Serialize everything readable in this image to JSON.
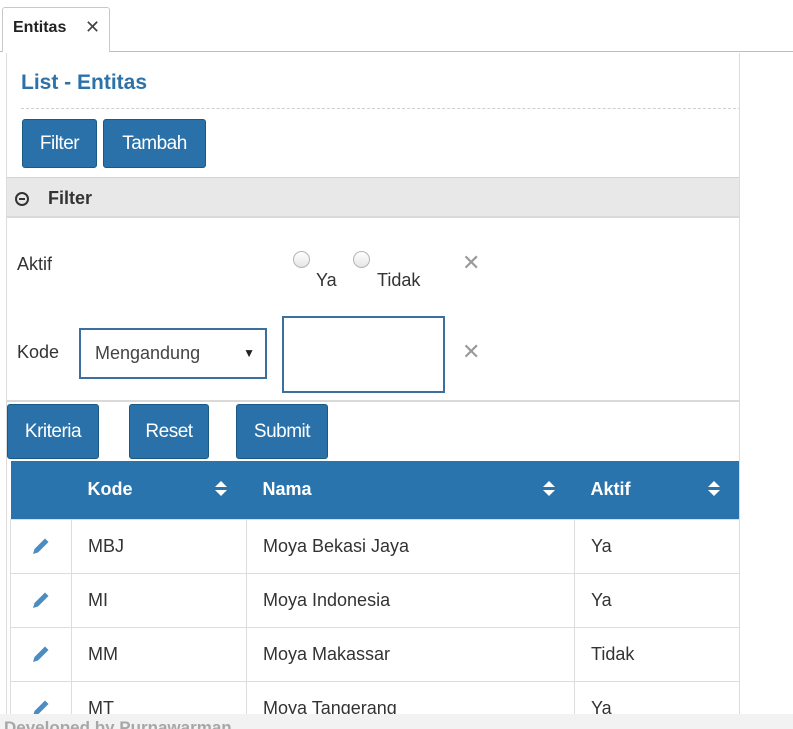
{
  "tab": {
    "label": "Entitas",
    "close": "✕"
  },
  "page": {
    "title": "List - Entitas"
  },
  "toolbar": {
    "filter_label": "Filter",
    "add_label": "Tambah"
  },
  "filter": {
    "title": "Filter",
    "aktif": {
      "label": "Aktif",
      "option_yes": "Ya",
      "option_no": "Tidak"
    },
    "kode": {
      "label": "Kode",
      "operator": "Mengandung",
      "value": ""
    },
    "clear": "✕"
  },
  "actions": {
    "criteria_label": "Kriteria",
    "reset_label": "Reset",
    "submit_label": "Submit"
  },
  "table": {
    "columns": [
      "Kode",
      "Nama",
      "Aktif"
    ],
    "rows": [
      {
        "kode": "MBJ",
        "nama": "Moya Bekasi Jaya",
        "aktif": "Ya"
      },
      {
        "kode": "MI",
        "nama": "Moya Indonesia",
        "aktif": "Ya"
      },
      {
        "kode": "MM",
        "nama": "Moya Makassar",
        "aktif": "Tidak"
      },
      {
        "kode": "MT",
        "nama": "Moya Tangerang",
        "aktif": "Ya"
      }
    ]
  },
  "footer": {
    "text": "Developed by Purnawarman"
  },
  "colors": {
    "primary": "#2971a8",
    "title": "#2c72a9",
    "header": "#2a74ad"
  }
}
